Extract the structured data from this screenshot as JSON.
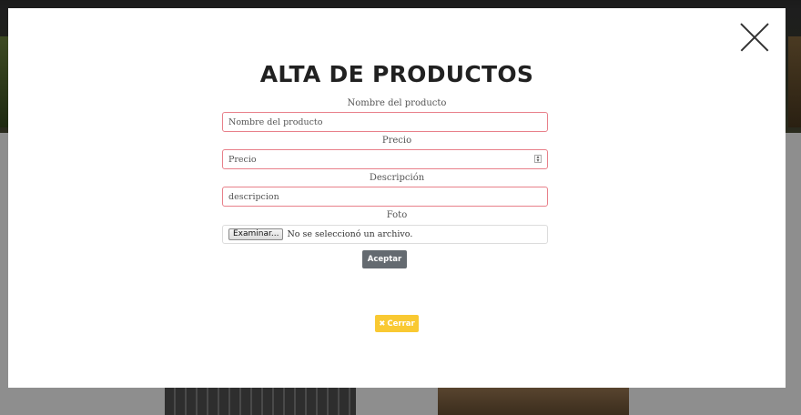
{
  "modal": {
    "title": "ALTA DE PRODUCTOS",
    "close_icon": "close-x-icon"
  },
  "form": {
    "name_label": "Nombre del producto",
    "name_placeholder": "Nombre del producto",
    "price_label": "Precio",
    "price_placeholder": "Precio",
    "description_label": "Descripción",
    "description_placeholder": "descripcion",
    "photo_label": "Foto",
    "file_button": "Examinar...",
    "file_status": "No se seleccionó un archivo.",
    "accept_button": "Aceptar"
  },
  "footer": {
    "close_icon_glyph": "✖",
    "close_button": "Cerrar"
  },
  "colors": {
    "invalid_border": "#e8808a",
    "accept_bg": "#646a70",
    "close_bg": "#f9c932"
  }
}
